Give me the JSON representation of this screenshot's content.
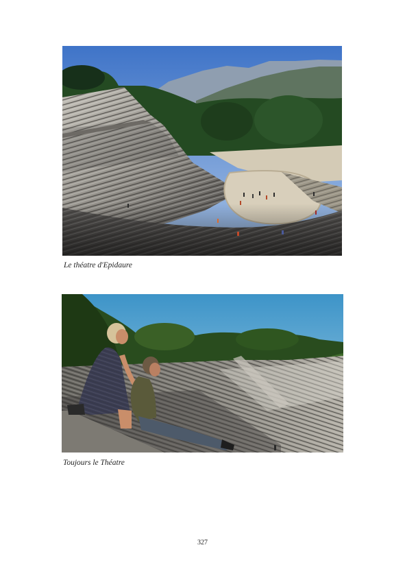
{
  "figures": [
    {
      "caption": "Le théatre d'Epidaure",
      "alt": "Le théatre d'Epidaure"
    },
    {
      "caption": "Toujours le Théatre",
      "alt": "Toujours le Théatre"
    }
  ],
  "page_number": "327",
  "colors": {
    "background": "#ffffff",
    "text": "#222222",
    "sky_top": "#3f74c8",
    "sky_bottom": "#a9c4e6",
    "trees": "#244a22",
    "stone": "#a8a49a",
    "stone_shadow": "#4c4a48",
    "orchestra": "#d4cbb6"
  }
}
